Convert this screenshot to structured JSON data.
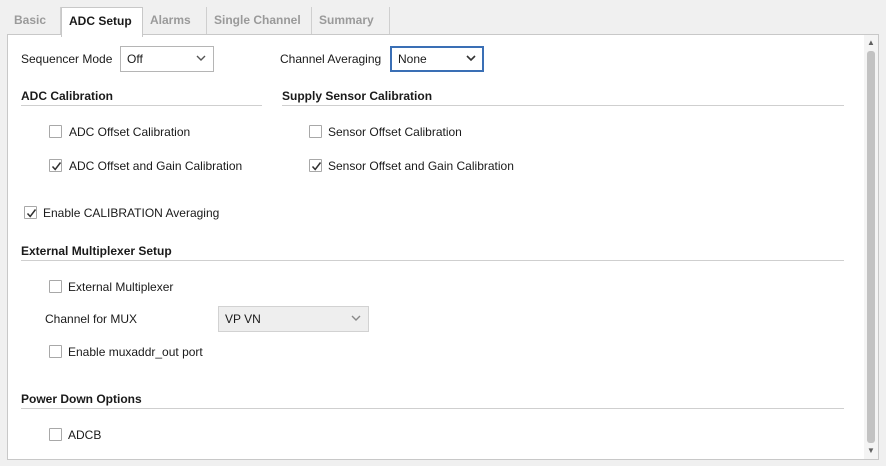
{
  "tabs": [
    {
      "label": "Basic",
      "active": false
    },
    {
      "label": "ADC Setup",
      "active": true
    },
    {
      "label": "Alarms",
      "active": false
    },
    {
      "label": "Single Channel",
      "active": false
    },
    {
      "label": "Summary",
      "active": false
    }
  ],
  "sequencer": {
    "label": "Sequencer Mode",
    "value": "Off"
  },
  "averaging": {
    "label": "Channel Averaging",
    "value": "None"
  },
  "adc_calibration": {
    "title": "ADC Calibration",
    "offset": {
      "label": "ADC Offset Calibration",
      "checked": false
    },
    "offset_gain": {
      "label": "ADC Offset and Gain Calibration",
      "checked": true
    }
  },
  "supply_calibration": {
    "title": "Supply Sensor Calibration",
    "offset": {
      "label": "Sensor Offset Calibration",
      "checked": false
    },
    "offset_gain": {
      "label": "Sensor Offset and Gain Calibration",
      "checked": true
    }
  },
  "enable_cal_avg": {
    "label": "Enable CALIBRATION Averaging",
    "checked": true
  },
  "ext_mux": {
    "title": "External Multiplexer Setup",
    "external": {
      "label": "External Multiplexer",
      "checked": false
    },
    "channel_label": "Channel for MUX",
    "channel_value": "VP VN",
    "muxaddr": {
      "label": "Enable muxaddr_out port",
      "checked": false
    }
  },
  "power_down": {
    "title": "Power Down Options",
    "adcb": {
      "label": "ADCB",
      "checked": false
    }
  },
  "colors": {
    "focus": "#3a6fb5",
    "tab_inactive": "#9a9a9a"
  },
  "icons": [
    "chevron-down-icon",
    "checkmark-icon",
    "scroll-up-icon",
    "scroll-down-icon"
  ]
}
